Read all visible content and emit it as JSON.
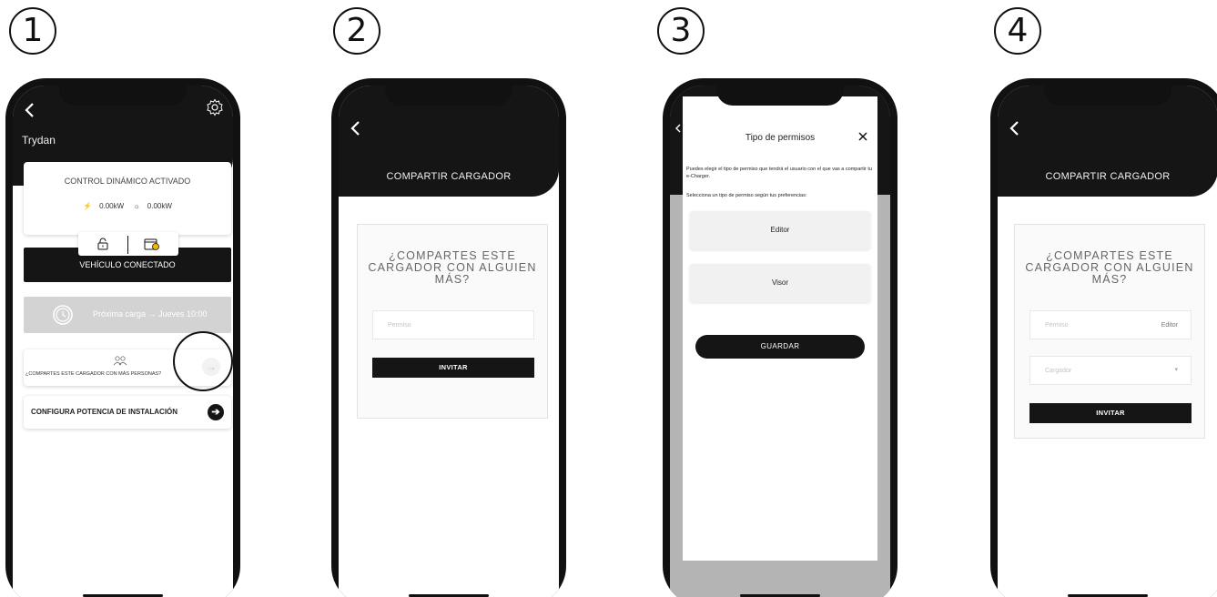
{
  "steps": [
    "1",
    "2",
    "3",
    "4"
  ],
  "screen1": {
    "charger_name": "Trydan",
    "control_title": "CONTROL DINÁMICO ACTIVADO",
    "grid_power": "0.00kW",
    "solar_power": "0.00kW",
    "connected_label": "VEHÍCULO CONECTADO",
    "next_charge": "Próxima carga → Jueves 10:00",
    "share_text": "¿COMPARTES ESTE CARGADOR CON MÁS PERSONAS?",
    "power_config": "CONFIGURA POTENCIA DE INSTALACIÓN"
  },
  "screen2": {
    "title": "COMPARTIR CARGADOR",
    "question": "¿COMPARTES ESTE CARGADOR CON ALGUIEN MÁS?",
    "permission_placeholder": "Permiso",
    "invite_label": "INVITAR"
  },
  "screen3": {
    "modal_title": "Tipo de permisos",
    "description": "Puedes elegir el tipo de permiso que tendrá el usuario con el que vas a compartir tu e-Charger.",
    "hint": "Selecciona un tipo de permiso según tus preferencias:",
    "options": [
      "Editor",
      "Visor"
    ],
    "save_label": "GUARDAR"
  },
  "screen4": {
    "title": "COMPARTIR CARGADOR",
    "question": "¿COMPARTES ESTE CARGADOR CON ALGUIEN MÁS?",
    "permission_placeholder": "Permiso",
    "permission_value": "Editor",
    "charger_placeholder": "Cargador",
    "invite_label": "INVITAR"
  },
  "colors": {
    "dark": "#151515",
    "muted": "#d3d3d3",
    "overlay": "#b4b4b4"
  }
}
